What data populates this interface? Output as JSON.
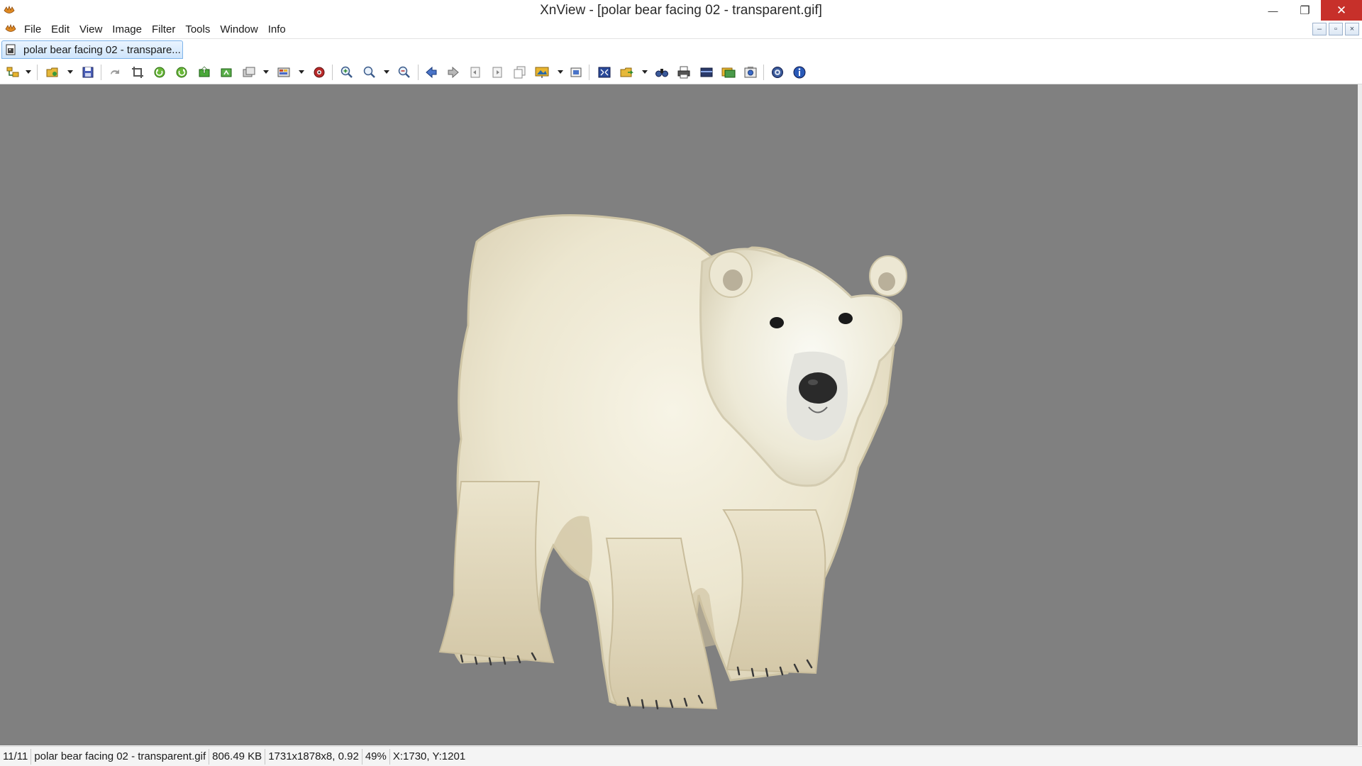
{
  "window": {
    "title": "XnView - [polar bear facing 02 - transparent.gif]",
    "minimize_glyph": "—",
    "restore_glyph": "❐",
    "close_glyph": "✕"
  },
  "menu": {
    "items": [
      "File",
      "Edit",
      "View",
      "Image",
      "Filter",
      "Tools",
      "Window",
      "Info"
    ]
  },
  "mdi": {
    "minimize_glyph": "–",
    "restore_glyph": "▫",
    "close_glyph": "×"
  },
  "tab": {
    "label": "polar bear facing 02 - transpare..."
  },
  "toolbar": {
    "icons": [
      "browser-icon",
      "open-folder-icon",
      "save-icon",
      "undo-icon",
      "crop-icon",
      "rotate-left-icon",
      "rotate-right-icon",
      "export-icon",
      "refresh-icon",
      "convert-icon",
      "color-adjust-icon",
      "red-eye-icon",
      "zoom-in-icon",
      "zoom-fit-icon",
      "zoom-out-icon",
      "previous-icon",
      "next-icon",
      "first-page-icon",
      "last-page-icon",
      "multi-page-icon",
      "slideshow-icon",
      "screen-capture-icon",
      "fullscreen-icon",
      "copy-to-icon",
      "find-icon",
      "print-icon",
      "scanner-icon",
      "wallpaper-icon",
      "webcam-icon",
      "settings-icon",
      "about-icon"
    ]
  },
  "image": {
    "subject": "polar-bear",
    "background_color": "#808080"
  },
  "status": {
    "position": "11/11",
    "filename": "polar bear facing 02 - transparent.gif",
    "filesize": "806.49 KB",
    "dimensions": "1731x1878x8, 0.92",
    "zoom": "49%",
    "coords": "X:1730, Y:1201"
  }
}
